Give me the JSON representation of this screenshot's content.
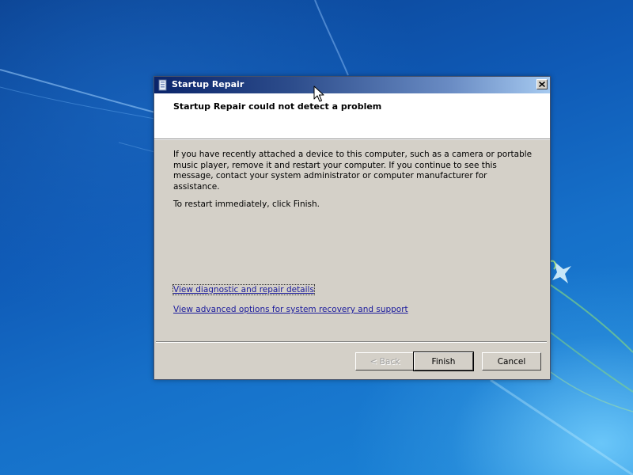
{
  "window": {
    "title": "Startup Repair",
    "close_glyph": "✕"
  },
  "header": {
    "title": "Startup Repair could not detect a problem"
  },
  "body": {
    "message": "If you have recently attached a device to this computer, such as a camera or portable music player, remove it and restart your computer. If you continue to see this message, contact your system administrator or computer manufacturer for assistance.",
    "restart_instruction": "To restart immediately, click Finish."
  },
  "links": {
    "diagnostic": "View diagnostic and repair details",
    "advanced": "View advanced options for system recovery and support"
  },
  "buttons": {
    "back": "< Back",
    "finish": "Finish",
    "cancel": "Cancel"
  },
  "colors": {
    "titlebar_start": "#0a246a",
    "titlebar_end": "#a6caf0",
    "dialog_face": "#d4d0c8",
    "link": "#1a1a9c",
    "desktop": "#1670c9"
  },
  "icons": {
    "title_icon": "startup-repair-icon",
    "close": "close-icon",
    "cursor": "mouse-pointer-icon"
  }
}
